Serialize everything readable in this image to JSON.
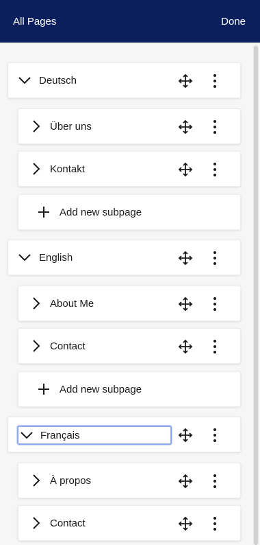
{
  "header": {
    "title": "All Pages",
    "done_label": "Done"
  },
  "languages": [
    {
      "label": "Deutsch",
      "subpages": [
        "Über uns",
        "Kontakt"
      ],
      "add_label": "Add new subpage"
    },
    {
      "label": "English",
      "subpages": [
        "About Me",
        "Contact"
      ],
      "add_label": "Add new subpage"
    },
    {
      "label": "Français",
      "subpages": [
        "À propos",
        "Contact"
      ],
      "editing": true
    }
  ],
  "icons": {
    "expanded": "chevron-down-icon",
    "collapsed": "chevron-right-icon",
    "move": "move-icon",
    "more": "more-vertical-icon",
    "add": "plus-icon"
  },
  "colors": {
    "header_bg": "#0b1f5c",
    "focus_ring": "#8fa8f0"
  }
}
